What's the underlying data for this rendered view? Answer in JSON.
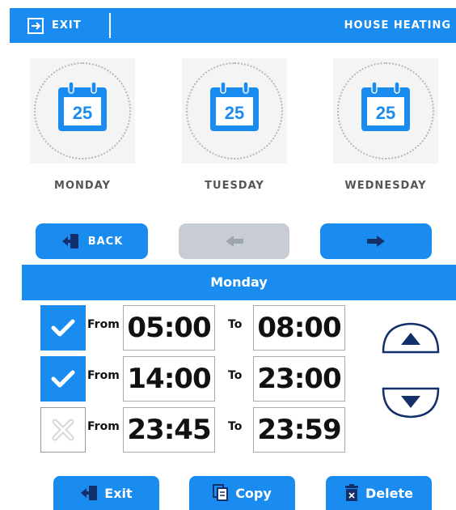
{
  "header": {
    "exit_label": "EXIT",
    "title": "HOUSE HEATING"
  },
  "days": [
    {
      "label": "MONDAY",
      "calendar_number": "25"
    },
    {
      "label": "TUESDAY",
      "calendar_number": "25"
    },
    {
      "label": "WEDNESDAY",
      "calendar_number": "25"
    }
  ],
  "nav": {
    "back_label": "BACK"
  },
  "selected_day": "Monday",
  "intervals": [
    {
      "enabled": true,
      "from_label": "From",
      "from": "05:00",
      "to_label": "To",
      "to": "08:00"
    },
    {
      "enabled": true,
      "from_label": "From",
      "from": "14:00",
      "to_label": "To",
      "to": "23:00"
    },
    {
      "enabled": false,
      "from_label": "From",
      "from": "23:45",
      "to_label": "To",
      "to": "23:59"
    }
  ],
  "footer": {
    "exit_label": "Exit",
    "copy_label": "Copy",
    "delete_label": "Delete"
  },
  "colors": {
    "accent": "#1a8cf0",
    "disabled": "#c8cdd3",
    "navy": "#14306b"
  }
}
